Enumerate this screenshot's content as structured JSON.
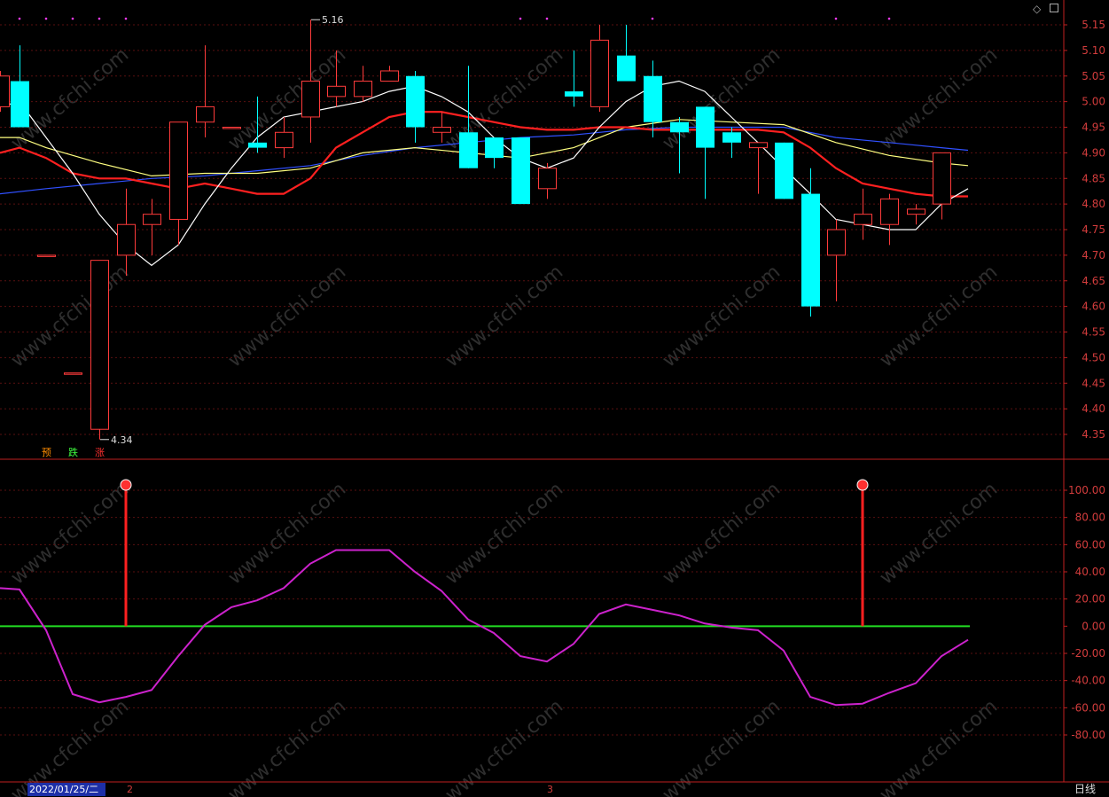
{
  "chart_data": [
    {
      "type": "candlestick",
      "ylim": [
        4.32,
        5.18
      ],
      "y_ticks": [
        "5.15",
        "5.10",
        "5.05",
        "5.00",
        "4.95",
        "4.90",
        "4.85",
        "4.80",
        "4.75",
        "4.70",
        "4.65",
        "4.60",
        "4.55",
        "4.50",
        "4.45",
        "4.40",
        "4.35"
      ],
      "max_label": "5.16",
      "min_label": "4.34",
      "candles": [
        {
          "o": 4.99,
          "h": 5.06,
          "l": 4.98,
          "c": 5.05
        },
        {
          "o": 5.04,
          "h": 5.11,
          "l": 4.95,
          "c": 4.95
        },
        {
          "o": 4.7,
          "h": 4.7,
          "l": 4.7,
          "c": 4.7
        },
        {
          "o": 4.47,
          "h": 4.47,
          "l": 4.47,
          "c": 4.47
        },
        {
          "o": 4.36,
          "h": 4.69,
          "l": 4.34,
          "c": 4.69
        },
        {
          "o": 4.7,
          "h": 4.83,
          "l": 4.66,
          "c": 4.76
        },
        {
          "o": 4.76,
          "h": 4.81,
          "l": 4.7,
          "c": 4.78
        },
        {
          "o": 4.77,
          "h": 4.96,
          "l": 4.72,
          "c": 4.96
        },
        {
          "o": 4.96,
          "h": 5.11,
          "l": 4.93,
          "c": 4.99
        },
        {
          "o": 4.95,
          "h": 4.95,
          "l": 4.95,
          "c": 4.95
        },
        {
          "o": 4.92,
          "h": 5.01,
          "l": 4.9,
          "c": 4.91
        },
        {
          "o": 4.91,
          "h": 4.97,
          "l": 4.89,
          "c": 4.94
        },
        {
          "o": 4.97,
          "h": 5.16,
          "l": 4.92,
          "c": 5.04
        },
        {
          "o": 5.01,
          "h": 5.1,
          "l": 4.99,
          "c": 5.03
        },
        {
          "o": 5.01,
          "h": 5.07,
          "l": 5.0,
          "c": 5.04
        },
        {
          "o": 5.04,
          "h": 5.07,
          "l": 5.04,
          "c": 5.06
        },
        {
          "o": 5.05,
          "h": 5.06,
          "l": 4.92,
          "c": 4.95
        },
        {
          "o": 4.94,
          "h": 4.98,
          "l": 4.92,
          "c": 4.95
        },
        {
          "o": 4.94,
          "h": 5.07,
          "l": 4.87,
          "c": 4.87
        },
        {
          "o": 4.93,
          "h": 4.93,
          "l": 4.87,
          "c": 4.89
        },
        {
          "o": 4.93,
          "h": 4.93,
          "l": 4.8,
          "c": 4.8
        },
        {
          "o": 4.83,
          "h": 4.88,
          "l": 4.81,
          "c": 4.87
        },
        {
          "o": 5.02,
          "h": 5.1,
          "l": 4.99,
          "c": 5.01
        },
        {
          "o": 4.99,
          "h": 5.15,
          "l": 4.98,
          "c": 5.12
        },
        {
          "o": 5.09,
          "h": 5.15,
          "l": 5.04,
          "c": 5.04
        },
        {
          "o": 5.05,
          "h": 5.08,
          "l": 4.93,
          "c": 4.96
        },
        {
          "o": 4.96,
          "h": 4.97,
          "l": 4.86,
          "c": 4.94
        },
        {
          "o": 4.99,
          "h": 4.99,
          "l": 4.81,
          "c": 4.91
        },
        {
          "o": 4.94,
          "h": 4.95,
          "l": 4.89,
          "c": 4.92
        },
        {
          "o": 4.91,
          "h": 4.92,
          "l": 4.82,
          "c": 4.92
        },
        {
          "o": 4.92,
          "h": 4.92,
          "l": 4.81,
          "c": 4.81
        },
        {
          "o": 4.82,
          "h": 4.87,
          "l": 4.58,
          "c": 4.6
        },
        {
          "o": 4.7,
          "h": 4.77,
          "l": 4.61,
          "c": 4.75
        },
        {
          "o": 4.76,
          "h": 4.83,
          "l": 4.73,
          "c": 4.78
        },
        {
          "o": 4.76,
          "h": 4.82,
          "l": 4.72,
          "c": 4.81
        },
        {
          "o": 4.78,
          "h": 4.8,
          "l": 4.76,
          "c": 4.79
        },
        {
          "o": 4.8,
          "h": 4.9,
          "l": 4.77,
          "c": 4.9
        }
      ],
      "candle_x": [
        0,
        22,
        52,
        82,
        112,
        142,
        171,
        201,
        231,
        261,
        290,
        320,
        350,
        379,
        409,
        439,
        468,
        498,
        528,
        557,
        587,
        617,
        647,
        676,
        706,
        736,
        766,
        795,
        825,
        855,
        884,
        914,
        943,
        973,
        1003,
        1033,
        1062
      ],
      "ma_white": {
        "color": "#ffffff",
        "x": [
          0,
          22,
          52,
          82,
          112,
          142,
          171,
          201,
          231,
          261,
          290,
          320,
          350,
          379,
          409,
          439,
          468,
          498,
          528,
          557,
          587,
          617,
          647,
          676,
          706,
          736,
          766,
          795,
          825,
          855,
          884,
          914,
          943,
          973,
          1003,
          1033,
          1062,
          1092
        ],
        "y": [
          4.99,
          5.0,
          4.93,
          4.86,
          4.78,
          4.72,
          4.68,
          4.72,
          4.8,
          4.87,
          4.93,
          4.97,
          4.98,
          4.99,
          5.0,
          5.02,
          5.03,
          5.01,
          4.98,
          4.93,
          4.89,
          4.87,
          4.89,
          4.95,
          5.0,
          5.03,
          5.04,
          5.02,
          4.97,
          4.92,
          4.87,
          4.82,
          4.77,
          4.76,
          4.75,
          4.75,
          4.8,
          4.83
        ]
      },
      "ma_red": {
        "color": "#ff2020",
        "x": [
          0,
          22,
          52,
          82,
          112,
          142,
          171,
          201,
          231,
          261,
          290,
          320,
          350,
          379,
          409,
          439,
          468,
          498,
          528,
          557,
          587,
          617,
          647,
          676,
          706,
          736,
          766,
          795,
          825,
          855,
          884,
          914,
          943,
          973,
          1003,
          1033,
          1062,
          1092
        ],
        "y": [
          4.9,
          4.91,
          4.89,
          4.86,
          4.85,
          4.85,
          4.84,
          4.83,
          4.84,
          4.83,
          4.82,
          4.82,
          4.85,
          4.91,
          4.94,
          4.97,
          4.98,
          4.98,
          4.97,
          4.96,
          4.95,
          4.945,
          4.945,
          4.95,
          4.95,
          4.945,
          4.945,
          4.945,
          4.945,
          4.945,
          4.94,
          4.91,
          4.87,
          4.84,
          4.83,
          4.82,
          4.815,
          4.815
        ]
      },
      "ma_yellow": {
        "color": "#ffff80",
        "x": [
          0,
          22,
          52,
          112,
          171,
          231,
          290,
          350,
          409,
          468,
          528,
          587,
          647,
          706,
          766,
          825,
          884,
          943,
          1003,
          1062,
          1092
        ],
        "y": [
          4.93,
          4.93,
          4.91,
          4.88,
          4.855,
          4.86,
          4.86,
          4.87,
          4.9,
          4.91,
          4.9,
          4.89,
          4.91,
          4.95,
          4.965,
          4.96,
          4.955,
          4.92,
          4.895,
          4.88,
          4.875
        ]
      },
      "ma_blue": {
        "color": "#3050ff",
        "x": [
          0,
          52,
          112,
          171,
          231,
          290,
          350,
          409,
          468,
          528,
          587,
          647,
          706,
          766,
          825,
          884,
          943,
          1003,
          1062,
          1092
        ],
        "y": [
          4.82,
          4.83,
          4.84,
          4.85,
          4.855,
          4.865,
          4.875,
          4.895,
          4.91,
          4.92,
          4.93,
          4.935,
          4.945,
          4.95,
          4.95,
          4.95,
          4.93,
          4.92,
          4.91,
          4.905
        ]
      },
      "tags": [
        {
          "text": "预",
          "color": "#ff8c00"
        },
        {
          "text": "跌",
          "color": "#40ff40"
        },
        {
          "text": "涨",
          "color": "#ff3030"
        }
      ]
    },
    {
      "type": "line",
      "ylim": [
        -105,
        118
      ],
      "y_ticks": [
        "100.00",
        "80.00",
        "60.00",
        "40.00",
        "20.00",
        "0.00",
        "-20.00",
        "-40.00",
        "-60.00",
        "-80.00"
      ],
      "tick_values": [
        100,
        80,
        60,
        40,
        20,
        0,
        -20,
        -40,
        -60,
        -80
      ],
      "oscillator": {
        "color": "#cc22cc",
        "x": [
          0,
          22,
          52,
          82,
          112,
          142,
          171,
          201,
          231,
          261,
          290,
          320,
          350,
          379,
          409,
          439,
          468,
          498,
          528,
          557,
          587,
          617,
          647,
          676,
          706,
          736,
          766,
          795,
          825,
          855,
          884,
          914,
          943,
          973,
          1003,
          1033,
          1062,
          1092
        ],
        "y": [
          28,
          27,
          -3,
          -50,
          -56,
          -52,
          -47,
          -22,
          1,
          14,
          19,
          28,
          46,
          56,
          56,
          56,
          40,
          26,
          5,
          -5,
          -22,
          -26,
          -13,
          9,
          16,
          12,
          8,
          2,
          -1,
          -3,
          -18,
          -52,
          -58,
          -57,
          -49,
          -42,
          -22,
          -10
        ]
      },
      "zero_line": {
        "color": "#22dd22",
        "value": 0
      },
      "signals": [
        {
          "x": 142,
          "value": 100
        },
        {
          "x": 973,
          "value": 100
        }
      ]
    }
  ],
  "x_axis": {
    "date_label": "2022/01/25/二",
    "marks": [
      "2",
      "3"
    ]
  },
  "period_label": "日线",
  "watermark": "www.cfchi.com"
}
